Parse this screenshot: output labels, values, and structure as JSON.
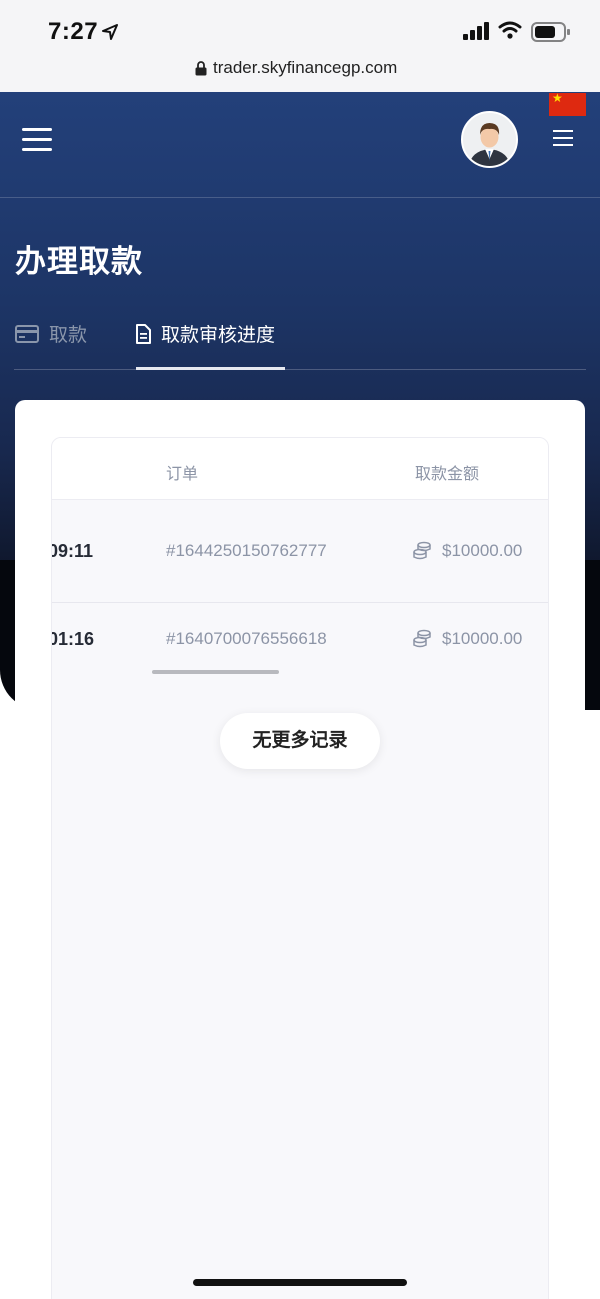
{
  "status_bar": {
    "time": "7:27"
  },
  "browser": {
    "url": "trader.skyfinancegp.com"
  },
  "page": {
    "title": "办理取款"
  },
  "tabs": [
    {
      "label": "取款",
      "icon": "credit-card-icon",
      "active": false
    },
    {
      "label": "取款审核进度",
      "icon": "document-icon",
      "active": true
    }
  ],
  "table": {
    "headers": {
      "order": "订单",
      "amount": "取款金额"
    },
    "rows": [
      {
        "time": "09:11",
        "order": "#1644250150762777",
        "amount": "$10000.00"
      },
      {
        "time": "01:16",
        "order": "#1640700076556618",
        "amount": "$10000.00"
      }
    ]
  },
  "no_more_label": "无更多记录",
  "colors": {
    "accent": "#23407a",
    "hero_bottom": "#05070d",
    "muted_text": "#8c94a6"
  }
}
